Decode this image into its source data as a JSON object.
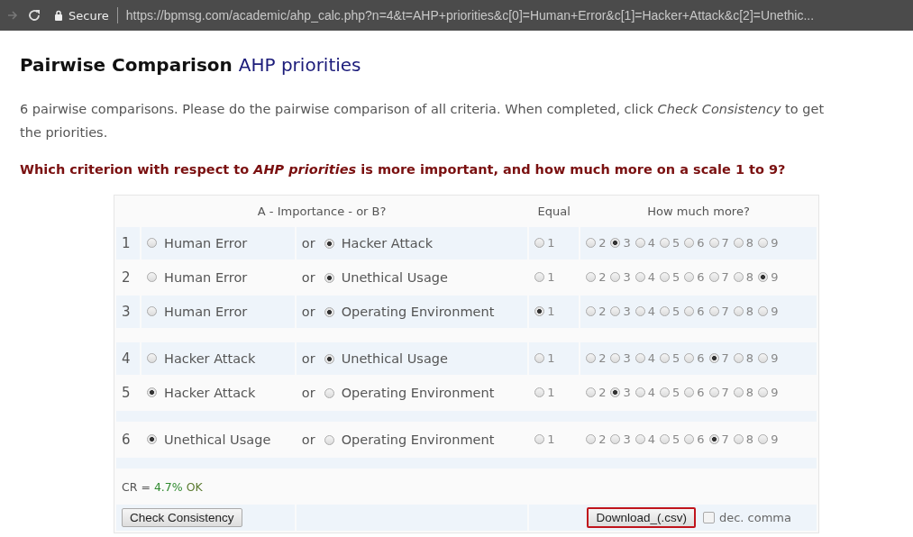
{
  "browser": {
    "secure_label": "Secure",
    "url": "https://bpmsg.com/academic/ahp_calc.php?n=4&t=AHP+priorities&c[0]=Human+Error&c[1]=Hacker+Attack&c[2]=Unethic..."
  },
  "heading": {
    "title": "Pairwise Comparison",
    "subject": "AHP priorities"
  },
  "intro": "6 pairwise comparisons. Please do the pairwise comparison of all criteria. When completed, click *Check Consistency* to get the priorities.",
  "question": "Which criterion with respect to *AHP priorities* is more important, and how much more on a scale 1 to 9?",
  "table": {
    "columns": [
      "A - Importance - or B?",
      "Equal",
      "How much more?"
    ],
    "rows": [
      {
        "number": "1",
        "a": {
          "label": "Human Error",
          "selected": false
        },
        "or": "or",
        "b": {
          "label": "Hacker Attack",
          "selected": true
        },
        "gap_after": false,
        "scale": [
          {
            "label": "1",
            "selected": false
          },
          {
            "label": "2",
            "selected": false
          },
          {
            "label": "3",
            "selected": true
          },
          {
            "label": "4",
            "selected": false
          },
          {
            "label": "5",
            "selected": false
          },
          {
            "label": "6",
            "selected": false
          },
          {
            "label": "7",
            "selected": false
          },
          {
            "label": "8",
            "selected": false
          },
          {
            "label": "9",
            "selected": false
          }
        ]
      },
      {
        "number": "2",
        "a": {
          "label": "Human Error",
          "selected": false
        },
        "or": "or",
        "b": {
          "label": "Unethical Usage",
          "selected": true
        },
        "gap_after": false,
        "scale": [
          {
            "label": "1",
            "selected": false
          },
          {
            "label": "2",
            "selected": false
          },
          {
            "label": "3",
            "selected": false
          },
          {
            "label": "4",
            "selected": false
          },
          {
            "label": "5",
            "selected": false
          },
          {
            "label": "6",
            "selected": false
          },
          {
            "label": "7",
            "selected": false
          },
          {
            "label": "8",
            "selected": false
          },
          {
            "label": "9",
            "selected": true
          }
        ]
      },
      {
        "number": "3",
        "a": {
          "label": "Human Error",
          "selected": false
        },
        "or": "or",
        "b": {
          "label": "Operating Environment",
          "selected": true
        },
        "gap_after": true,
        "scale": [
          {
            "label": "1",
            "selected": true
          },
          {
            "label": "2",
            "selected": false
          },
          {
            "label": "3",
            "selected": false
          },
          {
            "label": "4",
            "selected": false
          },
          {
            "label": "5",
            "selected": false
          },
          {
            "label": "6",
            "selected": false
          },
          {
            "label": "7",
            "selected": false
          },
          {
            "label": "8",
            "selected": false
          },
          {
            "label": "9",
            "selected": false
          }
        ]
      },
      {
        "number": "4",
        "a": {
          "label": "Hacker Attack",
          "selected": false
        },
        "or": "or",
        "b": {
          "label": "Unethical Usage",
          "selected": true
        },
        "gap_after": false,
        "scale": [
          {
            "label": "1",
            "selected": false
          },
          {
            "label": "2",
            "selected": false
          },
          {
            "label": "3",
            "selected": false
          },
          {
            "label": "4",
            "selected": false
          },
          {
            "label": "5",
            "selected": false
          },
          {
            "label": "6",
            "selected": false
          },
          {
            "label": "7",
            "selected": true
          },
          {
            "label": "8",
            "selected": false
          },
          {
            "label": "9",
            "selected": false
          }
        ]
      },
      {
        "number": "5",
        "a": {
          "label": "Hacker Attack",
          "selected": true
        },
        "or": "or",
        "b": {
          "label": "Operating Environment",
          "selected": false
        },
        "gap_after": true,
        "scale": [
          {
            "label": "1",
            "selected": false
          },
          {
            "label": "2",
            "selected": false
          },
          {
            "label": "3",
            "selected": true
          },
          {
            "label": "4",
            "selected": false
          },
          {
            "label": "5",
            "selected": false
          },
          {
            "label": "6",
            "selected": false
          },
          {
            "label": "7",
            "selected": false
          },
          {
            "label": "8",
            "selected": false
          },
          {
            "label": "9",
            "selected": false
          }
        ]
      },
      {
        "number": "6",
        "a": {
          "label": "Unethical Usage",
          "selected": true
        },
        "or": "or",
        "b": {
          "label": "Operating Environment",
          "selected": false
        },
        "gap_after": true,
        "scale": [
          {
            "label": "1",
            "selected": false
          },
          {
            "label": "2",
            "selected": false
          },
          {
            "label": "3",
            "selected": false
          },
          {
            "label": "4",
            "selected": false
          },
          {
            "label": "5",
            "selected": false
          },
          {
            "label": "6",
            "selected": false
          },
          {
            "label": "7",
            "selected": true
          },
          {
            "label": "8",
            "selected": false
          },
          {
            "label": "9",
            "selected": false
          }
        ]
      }
    ]
  },
  "consistency": {
    "label": "CR =",
    "value": "4.7%",
    "status": "OK"
  },
  "buttons": {
    "check": "Check Consistency",
    "download": "Download_(.csv)"
  },
  "decimal_comma": {
    "label": "dec. comma",
    "checked": false
  }
}
